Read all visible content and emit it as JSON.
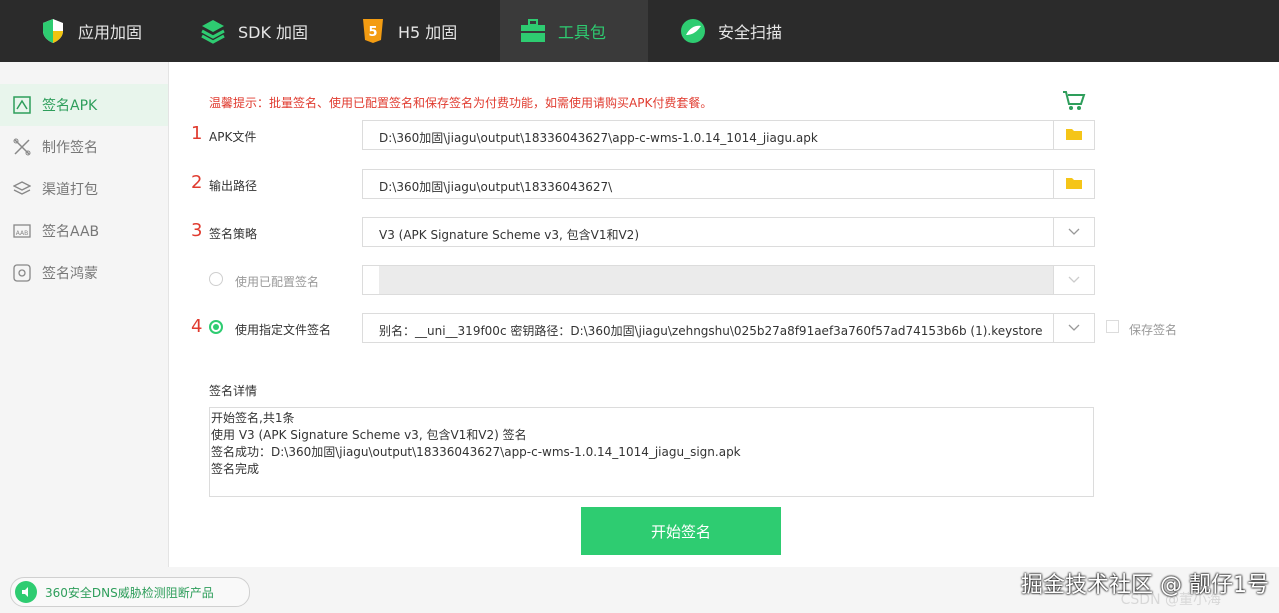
{
  "tabs": [
    {
      "label": "应用加固",
      "icon": "shield-icon"
    },
    {
      "label": "SDK 加固",
      "icon": "layers-icon"
    },
    {
      "label": "H5 加固",
      "icon": "html5-icon"
    },
    {
      "label": "工具包",
      "icon": "toolbox-icon"
    },
    {
      "label": "安全扫描",
      "icon": "scan-icon"
    }
  ],
  "sidebar": {
    "items": [
      {
        "label": "签名APK",
        "icon": "apk-sign-icon"
      },
      {
        "label": "制作签名",
        "icon": "tools-icon"
      },
      {
        "label": "渠道打包",
        "icon": "stack-icon"
      },
      {
        "label": "签名AAB",
        "icon": "aab-icon"
      },
      {
        "label": "签名鸿蒙",
        "icon": "harmony-icon"
      }
    ]
  },
  "main": {
    "notice": "温馨提示：批量签名、使用已配置签名和保存签名为付费功能，如需使用请购买APK付费套餐。",
    "apk": {
      "num": "1",
      "label": "APK文件",
      "value": "D:\\360加固\\jiagu\\output\\18336043627\\app-c-wms-1.0.14_1014_jiagu.apk"
    },
    "output": {
      "num": "2",
      "label": "输出路径",
      "value": "D:\\360加固\\jiagu\\output\\18336043627\\"
    },
    "strategy": {
      "num": "3",
      "label": "签名策略",
      "value": "V3 (APK Signature Scheme v3, 包含V1和V2)"
    },
    "configured": {
      "label": "使用已配置签名"
    },
    "file_sign": {
      "num": "4",
      "label": "使用指定文件签名",
      "value": "别名：__uni__319f00c 密钥路径：D:\\360加固\\jiagu\\zehngshu\\025b27a8f91aef3a760f57ad74153b6b (1).keystore"
    },
    "save_sign": "保存签名",
    "detail_title": "签名详情",
    "detail_lines": [
      "开始签名,共1条",
      "使用 V3 (APK Signature Scheme v3, 包含V1和V2) 签名",
      "签名成功：D:\\360加固\\jiagu\\output\\18336043627\\app-c-wms-1.0.14_1014_jiagu_sign.apk",
      "签名完成"
    ],
    "start_button": "开始签名"
  },
  "footer": {
    "dns_label": "360安全DNS威胁检测阻断产品",
    "watermark": "掘金技术社区 @ 靓仔1号",
    "watermark2": "CSDN @董小海"
  },
  "colors": {
    "accent": "#2ecc71",
    "warning": "#e03b2f",
    "topbar": "#2b2b2b"
  }
}
